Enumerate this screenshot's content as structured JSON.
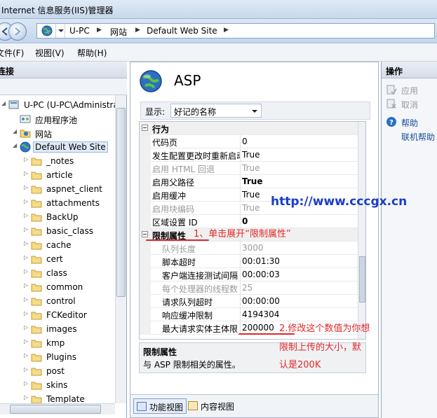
{
  "window": {
    "title": "Internet 信息服务(IIS)管理器"
  },
  "address": {
    "crumbs": [
      "U-PC",
      "网站",
      "Default Web Site"
    ]
  },
  "menu": [
    "文件(F)",
    "视图(V)",
    "帮助(H)"
  ],
  "connections": {
    "header": "连接",
    "tree": [
      {
        "label": "U-PC (U-PC\\Administrat",
        "icon": "server-icon",
        "expander": "◢",
        "level": 0
      },
      {
        "label": "应用程序池",
        "icon": "app-pool-icon",
        "expander": "",
        "level": 1
      },
      {
        "label": "网站",
        "icon": "sites-folder-icon",
        "expander": "◢",
        "level": 1
      },
      {
        "label": "Default Web Site",
        "icon": "globe-icon",
        "expander": "◢",
        "level": 2,
        "selected": true
      },
      {
        "label": "_notes",
        "icon": "folder-icon",
        "expander": "▷",
        "level": 3
      },
      {
        "label": "article",
        "icon": "folder-icon",
        "expander": "▷",
        "level": 3
      },
      {
        "label": "aspnet_client",
        "icon": "folder-icon",
        "expander": "▷",
        "level": 3
      },
      {
        "label": "attachments",
        "icon": "folder-icon",
        "expander": "▷",
        "level": 3
      },
      {
        "label": "BackUp",
        "icon": "folder-icon",
        "expander": "▷",
        "level": 3
      },
      {
        "label": "basic_class",
        "icon": "folder-icon",
        "expander": "▷",
        "level": 3
      },
      {
        "label": "cache",
        "icon": "folder-icon",
        "expander": "▷",
        "level": 3
      },
      {
        "label": "cert",
        "icon": "folder-icon",
        "expander": "▷",
        "level": 3
      },
      {
        "label": "class",
        "icon": "folder-icon",
        "expander": "▷",
        "level": 3
      },
      {
        "label": "common",
        "icon": "folder-icon",
        "expander": "▷",
        "level": 3
      },
      {
        "label": "control",
        "icon": "folder-icon",
        "expander": "▷",
        "level": 3
      },
      {
        "label": "FCKeditor",
        "icon": "folder-icon",
        "expander": "▷",
        "level": 3
      },
      {
        "label": "images",
        "icon": "folder-icon",
        "expander": "▷",
        "level": 3
      },
      {
        "label": "kmp",
        "icon": "folder-icon",
        "expander": "▷",
        "level": 3
      },
      {
        "label": "Plugins",
        "icon": "folder-icon",
        "expander": "▷",
        "level": 3
      },
      {
        "label": "post",
        "icon": "folder-icon",
        "expander": "▷",
        "level": 3
      },
      {
        "label": "skins",
        "icon": "folder-icon",
        "expander": "▷",
        "level": 3
      },
      {
        "label": "Template",
        "icon": "folder-icon",
        "expander": "▷",
        "level": 3
      }
    ]
  },
  "feature": {
    "title": "ASP",
    "show_label": "显示:",
    "show_value": "好记的名称",
    "grid": [
      {
        "type": "cat",
        "key": "行为"
      },
      {
        "key": "代码页",
        "value": "0"
      },
      {
        "key": "发生配置更改时重新启动",
        "value": "True"
      },
      {
        "key": "启用 HTML 回退",
        "value": "True",
        "disabled": true
      },
      {
        "key": "启用父路径",
        "value": "True",
        "bold": true
      },
      {
        "key": "启用缓冲",
        "value": "True"
      },
      {
        "key": "启用块编码",
        "value": "True",
        "disabled": true
      },
      {
        "key": "区域设置 ID",
        "value": "0",
        "bold": true
      },
      {
        "type": "cat",
        "key": "限制属性"
      },
      {
        "key": "队列长度",
        "value": "3000",
        "disabled": true,
        "sub": true
      },
      {
        "key": "脚本超时",
        "value": "00:01:30",
        "sub": true
      },
      {
        "key": "客户端连接测试间隔",
        "value": "00:00:03",
        "sub": true
      },
      {
        "key": "每个处理器的线程数",
        "value": "25",
        "disabled": true,
        "sub": true
      },
      {
        "key": "请求队列超时",
        "value": "00:00:00",
        "sub": true
      },
      {
        "key": "响应缓冲限制",
        "value": "4194304",
        "sub": true
      },
      {
        "key": "最大请求实体主体限",
        "value": "200000",
        "sub": true
      }
    ],
    "description": {
      "title": "限制属性",
      "text": "与 ASP 限制相关的属性。"
    },
    "views": [
      "功能视图",
      "内容视图"
    ]
  },
  "actions": {
    "header": "操作",
    "items": [
      {
        "label": "应用",
        "icon": "apply-icon",
        "disabled": true
      },
      {
        "label": "取消",
        "icon": "cancel-icon",
        "disabled": true
      },
      {
        "label": "帮助",
        "icon": "help-icon",
        "disabled": false
      },
      {
        "label": "联机帮助",
        "icon": "",
        "disabled": false
      }
    ]
  },
  "annotations": {
    "url": "http://www.cccgx.cn",
    "step1": "1、单击展开“限制属性”",
    "step2_line1": "2.修改这个数值为你想",
    "step2_line2": "限制上传的大小，默",
    "step2_line3": "认是200K",
    "color": "#e02828",
    "url_color": "#1a3ec8"
  }
}
